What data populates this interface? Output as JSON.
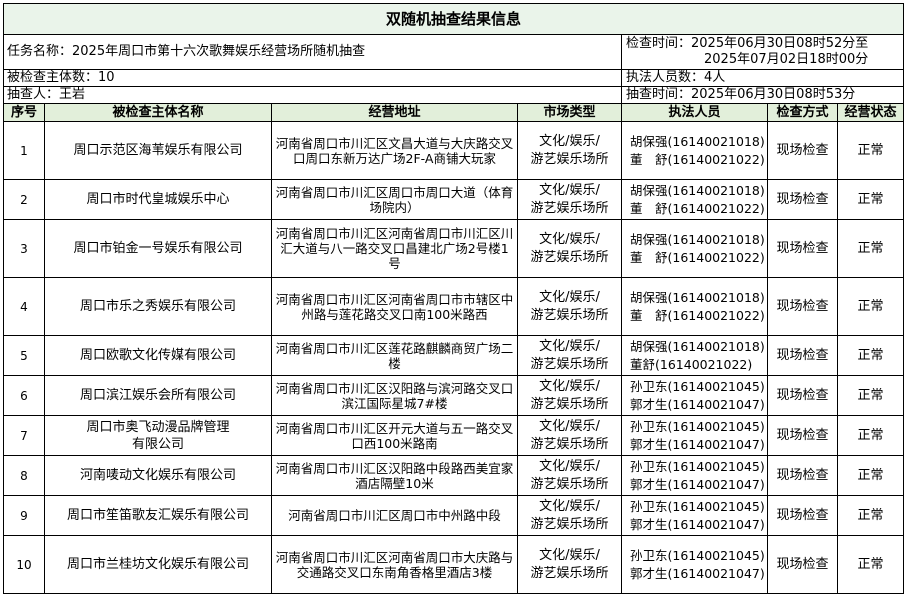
{
  "title": "双随机抽查结果信息",
  "task_name": "任务名称：2025年周口市第十六次歌舞娱乐经营场所随机抽查",
  "check_time_label": "检查时间：",
  "check_time_start": "2025年06月30日08时52分至",
  "check_time_end": "2025年07月02日18时00分",
  "subject_count": "被检查主体数：10",
  "officer_count": "执法人员数：4人",
  "sampler": "抽查人：王岩",
  "sample_time": "抽查时间：2025年06月30日08时53分",
  "headers": [
    "序号",
    "被检查主体名称",
    "经营地址",
    "市场类型",
    "执法人员",
    "检查方式",
    "经营状态"
  ],
  "rows": [
    {
      "no": "1",
      "name": [
        "周口示范区海苇娱乐有限公司"
      ],
      "addr": "河南省周口市川汇区文昌大道与大庆路交叉口周口东新万达广场2F-A商铺大玩家",
      "type": [
        "文化/娱乐/",
        "游艺娱乐场所"
      ],
      "officers": [
        "胡保强(16140021018)",
        "董　舒(16140021022)"
      ],
      "method": "现场检查",
      "status": "正常"
    },
    {
      "no": "2",
      "name": [
        "周口市时代皇城娱乐中心"
      ],
      "addr": "河南省周口市川汇区周口市周口大道（体育场院内）",
      "type": [
        "文化/娱乐/",
        "游艺娱乐场所"
      ],
      "officers": [
        "胡保强(16140021018)",
        "董　舒(16140021022)"
      ],
      "method": "现场检查",
      "status": "正常"
    },
    {
      "no": "3",
      "name": [
        "周口市铂金一号娱乐有限公司"
      ],
      "addr": "河南省周口市川汇区河南省周口市川汇区川汇大道与八一路交叉口昌建北广场2号楼1号",
      "type": [
        "文化/娱乐/",
        "游艺娱乐场所"
      ],
      "officers": [
        "胡保强(16140021018)",
        "董　舒(16140021022)"
      ],
      "method": "现场检查",
      "status": "正常"
    },
    {
      "no": "4",
      "name": [
        "周口市乐之秀娱乐有限公司"
      ],
      "addr": "河南省周口市川汇区河南省周口市市辖区中州路与莲花路交叉口南100米路西",
      "type": [
        "文化/娱乐/",
        "游艺娱乐场所"
      ],
      "officers": [
        "胡保强(16140021018)",
        "董　舒(16140021022)"
      ],
      "method": "现场检查",
      "status": "正常"
    },
    {
      "no": "5",
      "name": [
        "周口欧歌文化传媒有限公司"
      ],
      "addr": "河南省周口市川汇区莲花路麒麟商贸广场二楼",
      "type": [
        "文化/娱乐/",
        "游艺娱乐场所"
      ],
      "officers": [
        "胡保强(16140021018)",
        "董舒(16140021022)"
      ],
      "method": "现场检查",
      "status": "正常"
    },
    {
      "no": "6",
      "name": [
        "周口滨江娱乐会所有限公司"
      ],
      "addr": "河南省周口市川汇区汉阳路与滨河路交叉口滨江国际星城7#楼",
      "type": [
        "文化/娱乐/",
        "游艺娱乐场所"
      ],
      "officers": [
        "孙卫东(16140021045)",
        "郭才生(16140021047)"
      ],
      "method": "现场检查",
      "status": "正常"
    },
    {
      "no": "7",
      "name": [
        "周口市奥飞动漫品牌管理",
        "有限公司"
      ],
      "addr": "河南省周口市川汇区开元大道与五一路交叉口西100米路南",
      "type": [
        "文化/娱乐/",
        "游艺娱乐场所"
      ],
      "officers": [
        "孙卫东(16140021045)",
        "郭才生(16140021047)"
      ],
      "method": "现场检查",
      "status": "正常"
    },
    {
      "no": "8",
      "name": [
        "河南唛动文化娱乐有限公司"
      ],
      "addr": "河南省周口市川汇区汉阳路中段路西美宜家酒店隔壁10米",
      "type": [
        "文化/娱乐/",
        "游艺娱乐场所"
      ],
      "officers": [
        "孙卫东(16140021045)",
        "郭才生(16140021047)"
      ],
      "method": "现场检查",
      "status": "正常"
    },
    {
      "no": "9",
      "name": [
        "周口市笙笛歌友汇娱乐有限公司"
      ],
      "addr": "河南省周口市川汇区周口市中州路中段",
      "type": [
        "文化/娱乐/",
        "游艺娱乐场所"
      ],
      "officers": [
        "孙卫东(16140021045)",
        "郭才生(16140021047)"
      ],
      "method": "现场检查",
      "status": "正常"
    },
    {
      "no": "10",
      "name": [
        "周口市兰桂坊文化娱乐有限公司"
      ],
      "addr": "河南省周口市川汇区河南省周口市大庆路与交通路交叉口东南角香格里酒店3楼",
      "type": [
        "文化/娱乐/",
        "游艺娱乐场所"
      ],
      "officers": [
        "孙卫东(16140021045)",
        "郭才生(16140021047)"
      ],
      "method": "现场检查",
      "status": "正常"
    }
  ]
}
